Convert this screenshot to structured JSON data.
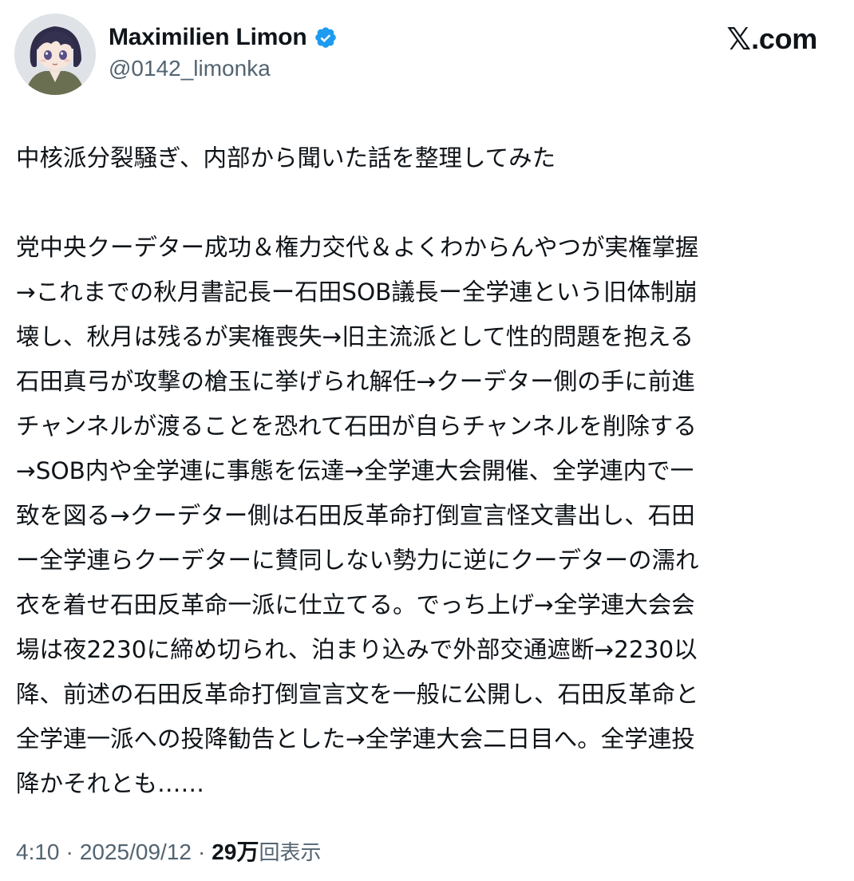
{
  "author": {
    "display_name": "Maximilien Limon",
    "handle": "@0142_limonka",
    "verified_icon": "verified-badge-icon",
    "avatar_icon": "anime-girl-avatar"
  },
  "brand": {
    "logo_glyph": "𝕏",
    "domain": ".com"
  },
  "tweet": {
    "first_line": "中核派分裂騒ぎ、内部から聞いた話を整理してみた",
    "body_lines": [
      "党中央クーデター成功＆権力交代＆よくわからんやつが実権掌握",
      "→これまでの秋月書記長ー石田SOB議長ー全学連という旧体制崩",
      "壊し、秋月は残るが実権喪失→旧主流派として性的問題を抱える",
      "石田真弓が攻撃の槍玉に挙げられ解任→クーデター側の手に前進",
      "チャンネルが渡ることを恐れて石田が自らチャンネルを削除する",
      "→SOB内や全学連に事態を伝達→全学連大会開催、全学連内で一",
      "致を図る→クーデター側は石田反革命打倒宣言怪文書出し、石田",
      "ー全学連らクーデターに賛同しない勢力に逆にクーデターの濡れ",
      "衣を着せ石田反革命一派に仕立てる。でっち上げ→全学連大会会",
      "場は夜2230に締め切られ、泊まり込みで外部交通遮断→2230以",
      "降、前述の石田反革命打倒宣言文を一般に公開し、石田反革命と",
      "全学連一派への投降勧告とした→全学連大会二日目へ。全学連投",
      "降かそれとも……"
    ]
  },
  "meta": {
    "time": "4:10",
    "separator": "·",
    "date": "2025/09/12",
    "views_count": "29万",
    "views_label": "回表示"
  },
  "colors": {
    "text": "#0f1419",
    "secondary": "#536471",
    "verified": "#1d9bf0"
  }
}
